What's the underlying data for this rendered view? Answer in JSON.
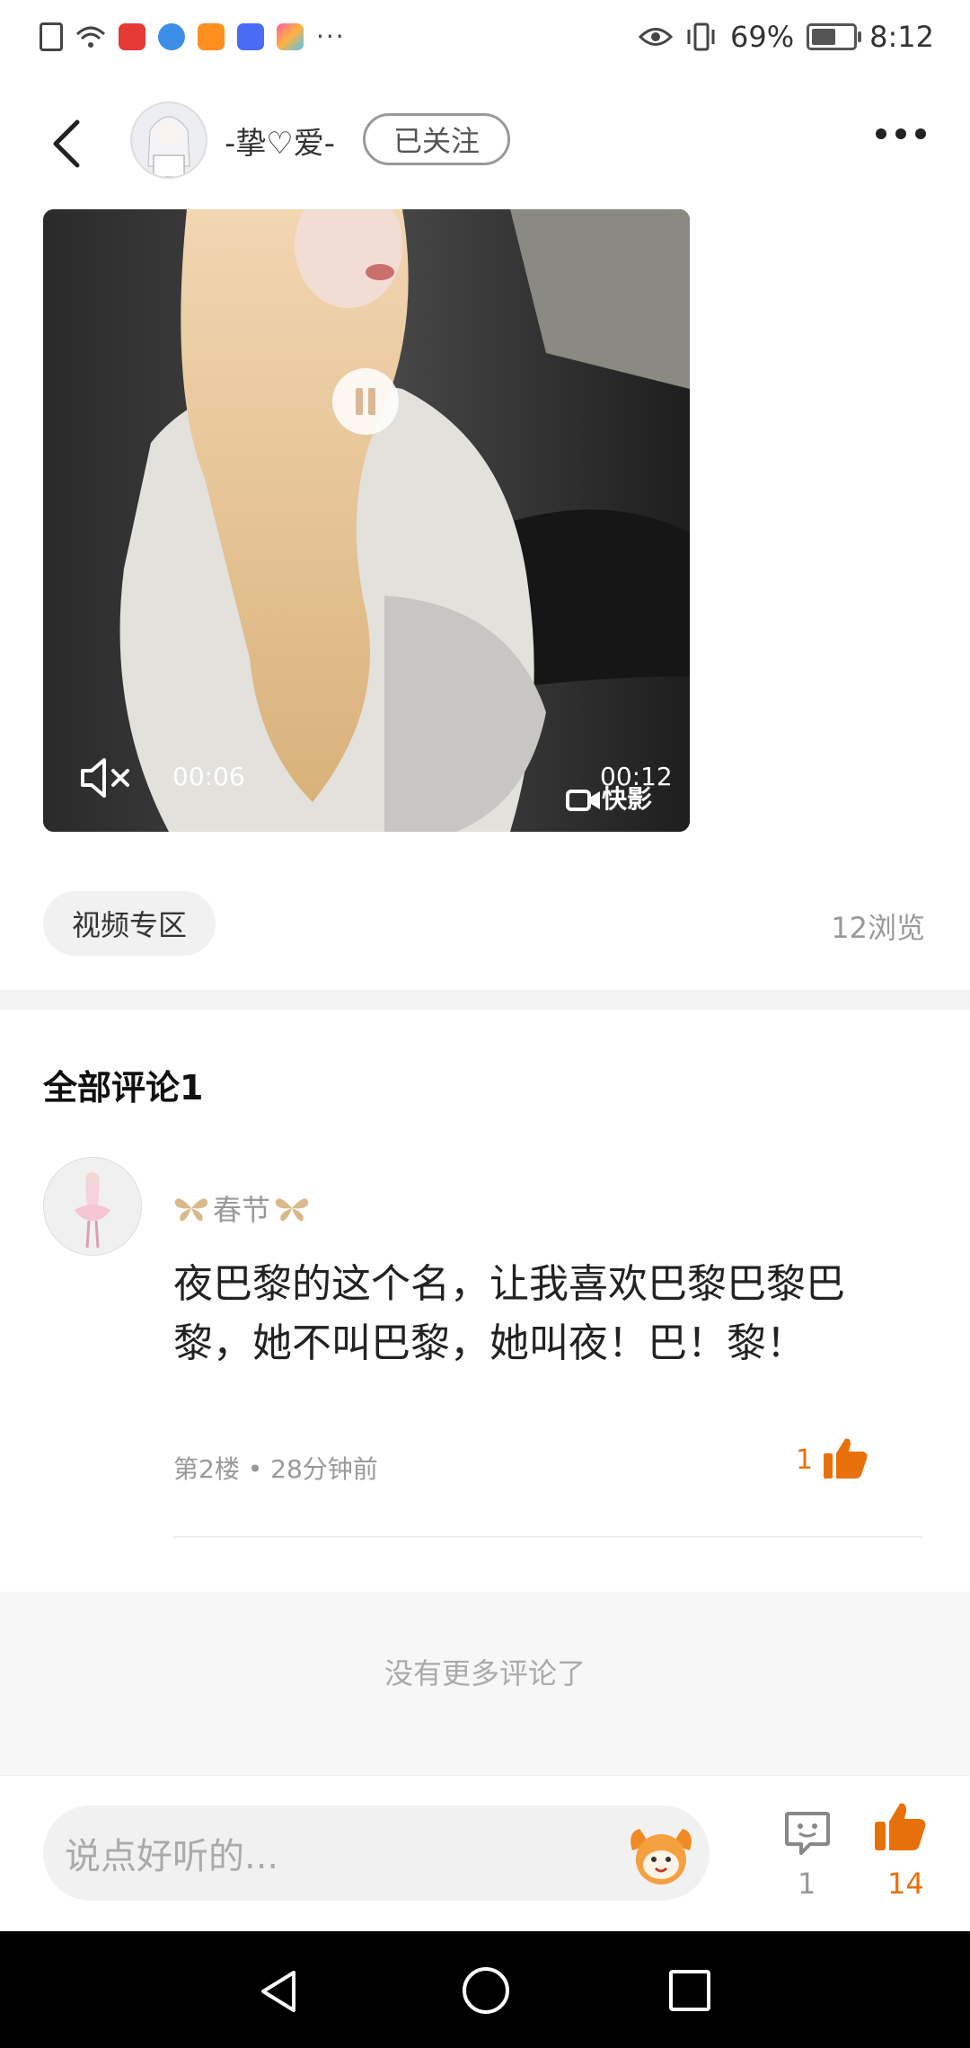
{
  "status_bar": {
    "battery": "69%",
    "battery_level": 0.69,
    "time": "8:12",
    "left_icons": [
      "notification-alert-icon",
      "wifi-icon",
      "app-icon-red",
      "app-icon-blue",
      "app-icon-orange",
      "music-icon",
      "app-icon-colorful",
      "more-dots-icon"
    ],
    "right_icons": [
      "eye-icon",
      "vibrate-icon",
      "battery-icon"
    ]
  },
  "header": {
    "username": "-挚♡爱-",
    "follow_label": "已关注"
  },
  "video": {
    "current_time": "00:06",
    "duration": "00:12",
    "brand": "快影"
  },
  "post": {
    "tag": "视频专区",
    "views": "12浏览"
  },
  "comments": {
    "title": "全部评论1",
    "items": [
      {
        "name": "春节",
        "name_decor_icon": "butterfly-icon",
        "text": "夜巴黎的这个名，让我喜欢巴黎巴黎巴黎，她不叫巴黎，她叫夜！巴！黎！",
        "floor": "第2楼",
        "time": "28分钟前",
        "likes": "1"
      }
    ],
    "no_more": "没有更多评论了"
  },
  "bottom_bar": {
    "input_placeholder": "说点好听的...",
    "comment_count": "1",
    "like_count": "14"
  },
  "colors": {
    "accent": "#e8700a",
    "muted": "#999999"
  }
}
